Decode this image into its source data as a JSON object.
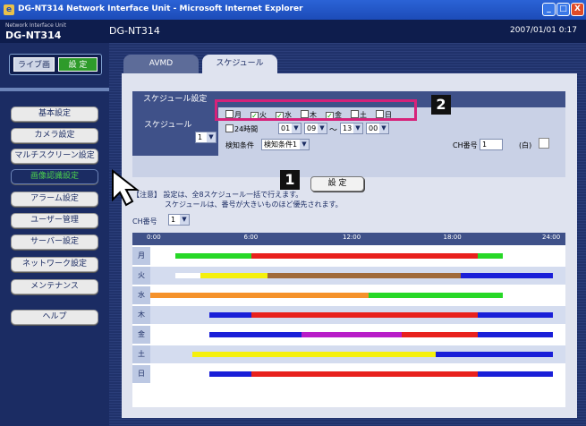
{
  "window": {
    "title": "DG-NT314 Network Interface Unit - Microsoft Internet Explorer",
    "controls": [
      "_",
      "□",
      "X"
    ]
  },
  "header": {
    "brand_small": "Network Interface Unit",
    "brand_big": "DG-NT314",
    "model": "DG-NT314",
    "datetime": "2007/01/01  0:17"
  },
  "sidebar": {
    "live_label": "ライブ画",
    "setup_label": "設 定",
    "items": [
      {
        "label": "基本設定",
        "active": false
      },
      {
        "label": "カメラ設定",
        "active": false
      },
      {
        "label": "マルチスクリーン設定",
        "active": false
      },
      {
        "label": "画像認識設定",
        "active": true
      },
      {
        "label": "アラーム設定",
        "active": false
      },
      {
        "label": "ユーザー管理",
        "active": false
      },
      {
        "label": "サーバー設定",
        "active": false
      },
      {
        "label": "ネットワーク設定",
        "active": false
      },
      {
        "label": "メンテナンス",
        "active": false
      },
      {
        "label": "ヘルプ",
        "active": false
      }
    ]
  },
  "tabs": [
    {
      "label": "AVMD",
      "active": false
    },
    {
      "label": "スケジュール",
      "active": true
    }
  ],
  "schedule": {
    "section_title": "スケジュール設定",
    "row_label": "スケジュール",
    "schedule_number": "1",
    "days": [
      {
        "label": "月",
        "checked": false
      },
      {
        "label": "火",
        "checked": true
      },
      {
        "label": "水",
        "checked": true
      },
      {
        "label": "木",
        "checked": false
      },
      {
        "label": "金",
        "checked": true
      },
      {
        "label": "土",
        "checked": false
      },
      {
        "label": "日",
        "checked": false
      }
    ],
    "all_day_label": "24時間",
    "start_hour": "01",
    "start_min": "09",
    "tilde": "～",
    "end_hour": "13",
    "end_min": "00",
    "condition_label": "検知条件",
    "condition_value": "検知条件1",
    "ch_label": "CH番号",
    "ch_value": "1",
    "white_label": "(白)",
    "apply_label": "設 定"
  },
  "annotations": {
    "badge1": "1",
    "badge2": "2"
  },
  "note": {
    "line1": "【注意】 設定は、全8スケジュール一括で行えます。",
    "line2": "スケジュールは、番号が大きいものほど優先されます。"
  },
  "ch_select": {
    "label": "CH番号",
    "value": "1"
  },
  "timeline": {
    "ticks": [
      "0:00",
      "6:00",
      "12:00",
      "18:00",
      "24:00"
    ],
    "colors": {
      "green": "#27d827",
      "red": "#e8211d",
      "blue": "#1a1fd8",
      "brown": "#a06a3a",
      "yellow": "#f5f00e",
      "orange": "#f5922b",
      "purple": "#b81cc8",
      "white": "#ffffff"
    },
    "rows": [
      {
        "day": "月",
        "segments": [
          [
            1.5,
            6,
            "green"
          ],
          [
            6,
            19.5,
            "red"
          ],
          [
            19.5,
            21,
            "green"
          ]
        ]
      },
      {
        "day": "火",
        "segments": [
          [
            1.5,
            3,
            "white"
          ],
          [
            3,
            7,
            "yellow"
          ],
          [
            7,
            18.5,
            "brown"
          ],
          [
            18.5,
            24,
            "blue"
          ]
        ]
      },
      {
        "day": "水",
        "segments": [
          [
            0,
            13,
            "orange"
          ],
          [
            13,
            21,
            "green"
          ]
        ]
      },
      {
        "day": "木",
        "segments": [
          [
            3.5,
            6,
            "blue"
          ],
          [
            6,
            19.5,
            "red"
          ],
          [
            19.5,
            24,
            "blue"
          ]
        ]
      },
      {
        "day": "金",
        "segments": [
          [
            1.5,
            3.5,
            "white"
          ],
          [
            3.5,
            9,
            "blue"
          ],
          [
            9,
            15,
            "purple"
          ],
          [
            15,
            19.5,
            "red"
          ],
          [
            19.5,
            24,
            "blue"
          ]
        ]
      },
      {
        "day": "土",
        "segments": [
          [
            2.5,
            17,
            "yellow"
          ],
          [
            17,
            24,
            "blue"
          ]
        ]
      },
      {
        "day": "日",
        "segments": [
          [
            3.5,
            6,
            "blue"
          ],
          [
            6,
            19.5,
            "red"
          ],
          [
            19.5,
            24,
            "blue"
          ]
        ]
      }
    ]
  }
}
